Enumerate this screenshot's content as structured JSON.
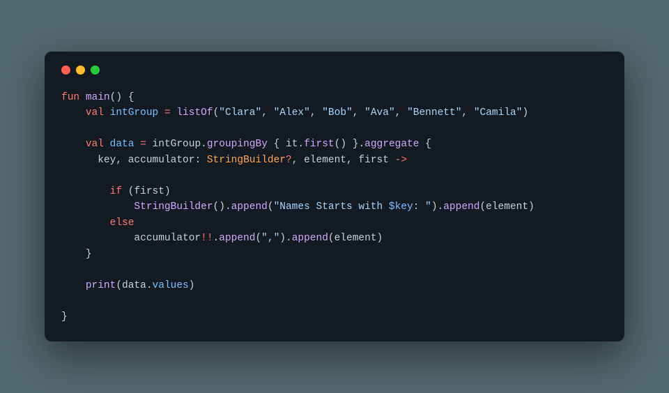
{
  "code": {
    "line1": {
      "fun": "fun",
      "main": "main",
      "parens": "()",
      "brace": " {"
    },
    "line2": {
      "indent": "    ",
      "val": "val",
      "sp1": " ",
      "intGroup": "intGroup",
      "sp2": " ",
      "eq": "=",
      "sp3": " ",
      "listOf": "listOf",
      "lparen": "(",
      "s1": "\"Clara\"",
      "c1": ", ",
      "s2": "\"Alex\"",
      "c2": ", ",
      "s3": "\"Bob\"",
      "c3": ", ",
      "s4": "\"Ava\"",
      "c4": ", ",
      "s5": "\"Bennett\"",
      "c5": ", ",
      "s6": "\"Camila\"",
      "rparen": ")"
    },
    "line3": "",
    "line4": {
      "indent": "    ",
      "val": "val",
      "sp1": " ",
      "data": "data",
      "sp2": " ",
      "eq": "=",
      "sp3": " ",
      "intGroup": "intGroup",
      "dot1": ".",
      "groupingBy": "groupingBy",
      "sp4": " ",
      "lbrace1": "{",
      "sp5": " ",
      "it": "it",
      "dot2": ".",
      "first": "first",
      "parens1": "()",
      "sp6": " ",
      "rbrace1": "}",
      "dot3": ".",
      "aggregate": "aggregate",
      "sp7": " ",
      "lbrace2": "{"
    },
    "line5": {
      "indent": "      ",
      "key": "key",
      "c1": ", ",
      "accumulator": "accumulator",
      "colon": ": ",
      "sb": "StringBuilder",
      "q": "?",
      "c2": ", ",
      "element": "element",
      "c3": ", ",
      "first": "first",
      "sp": " ",
      "arrow": "->"
    },
    "line6": "",
    "line7": {
      "indent": "        ",
      "if": "if",
      "sp": " ",
      "lparen": "(",
      "first": "first",
      "rparen": ")"
    },
    "line8": {
      "indent": "            ",
      "sb": "StringBuilder",
      "parens1": "()",
      "dot1": ".",
      "append1": "append",
      "lparen1": "(",
      "str1a": "\"Names Starts with ",
      "dollar": "$key",
      "str1b": ": \"",
      "rparen1": ")",
      "dot2": ".",
      "append2": "append",
      "lparen2": "(",
      "element": "element",
      "rparen2": ")"
    },
    "line9": {
      "indent": "        ",
      "else": "else"
    },
    "line10": {
      "indent": "            ",
      "accumulator": "accumulator",
      "bang": "!!",
      "dot1": ".",
      "append1": "append",
      "lparen1": "(",
      "str": "\",\"",
      "rparen1": ")",
      "dot2": ".",
      "append2": "append",
      "lparen2": "(",
      "element": "element",
      "rparen2": ")"
    },
    "line11": {
      "indent": "    ",
      "rbrace": "}"
    },
    "line12": "",
    "line13": {
      "indent": "    ",
      "print": "print",
      "lparen": "(",
      "data": "data",
      "dot": ".",
      "values": "values",
      "rparen": ")"
    },
    "line14": "",
    "line15": {
      "rbrace": "}"
    }
  }
}
